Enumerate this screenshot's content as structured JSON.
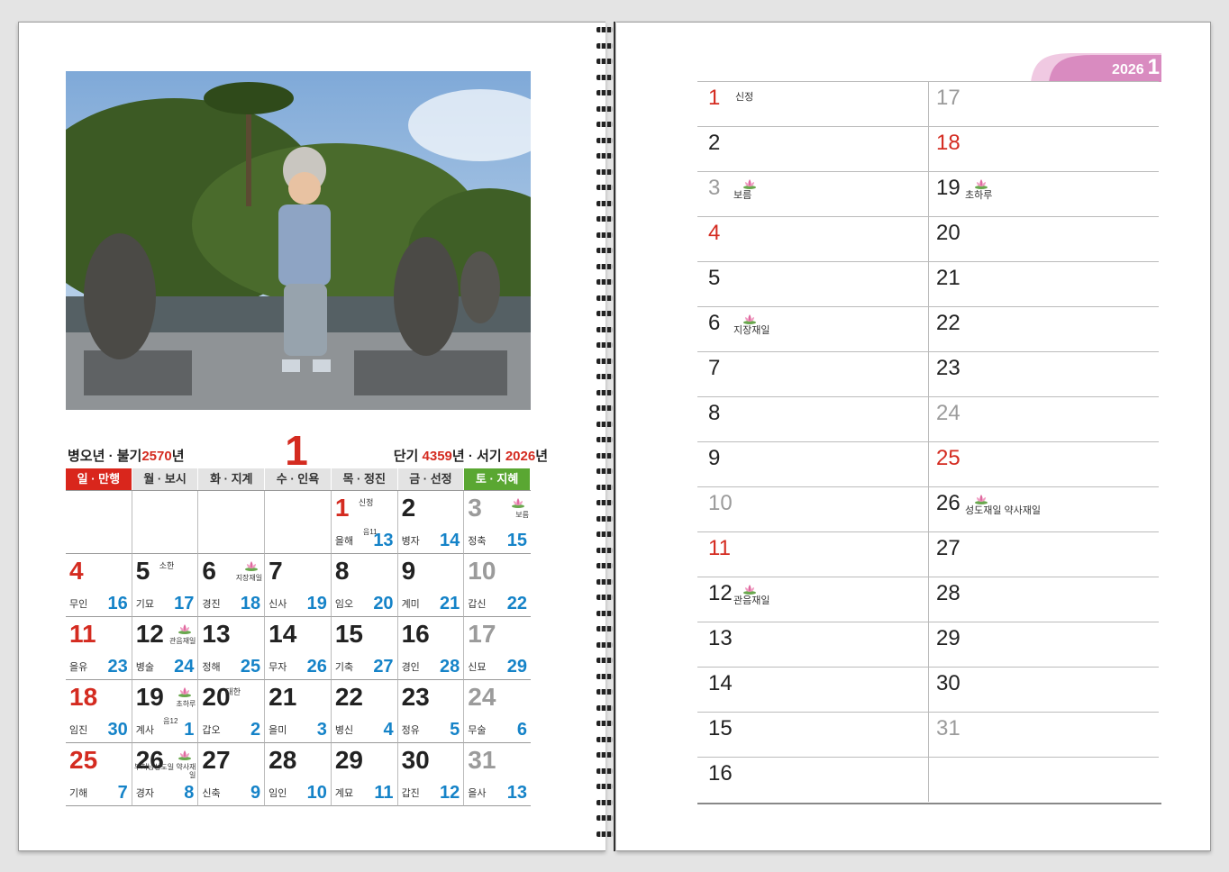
{
  "calendar": {
    "lunar_year_label": "병오년 · 불기",
    "buddhist_year": "2570",
    "year_suffix": "년",
    "month": "1",
    "dangi_label": "단기",
    "dangi_year": "4359",
    "dangi_suffix": "년 · 서기",
    "western_year": "2026",
    "western_suffix": "년",
    "weekdays": [
      {
        "label": "일 · 만행",
        "type": "sun"
      },
      {
        "label": "월 · 보시",
        "type": "day"
      },
      {
        "label": "화 · 지계",
        "type": "day"
      },
      {
        "label": "수 · 인욕",
        "type": "day"
      },
      {
        "label": "목 · 정진",
        "type": "day"
      },
      {
        "label": "금 · 선정",
        "type": "day"
      },
      {
        "label": "토 · 지혜",
        "type": "sat"
      }
    ],
    "cells": [
      {
        "day": "",
        "type": "day",
        "note": "",
        "ganzhi": "",
        "lunar": "",
        "lunar_note": "",
        "lotus": ""
      },
      {
        "day": "",
        "type": "day",
        "note": "",
        "ganzhi": "",
        "lunar": "",
        "lunar_note": "",
        "lotus": ""
      },
      {
        "day": "",
        "type": "day",
        "note": "",
        "ganzhi": "",
        "lunar": "",
        "lunar_note": "",
        "lotus": ""
      },
      {
        "day": "",
        "type": "day",
        "note": "",
        "ganzhi": "",
        "lunar": "",
        "lunar_note": "",
        "lotus": ""
      },
      {
        "day": "1",
        "type": "sun",
        "note": "신정",
        "ganzhi": "을해",
        "lunar": "13",
        "lunar_note": "음11",
        "lotus": ""
      },
      {
        "day": "2",
        "type": "day",
        "note": "",
        "ganzhi": "병자",
        "lunar": "14",
        "lunar_note": "",
        "lotus": ""
      },
      {
        "day": "3",
        "type": "sat",
        "note": "",
        "ganzhi": "정축",
        "lunar": "15",
        "lunar_note": "",
        "lotus": "보름"
      },
      {
        "day": "4",
        "type": "sun",
        "note": "",
        "ganzhi": "무인",
        "lunar": "16",
        "lunar_note": "",
        "lotus": ""
      },
      {
        "day": "5",
        "type": "day",
        "note": "소한",
        "ganzhi": "기묘",
        "lunar": "17",
        "lunar_note": "",
        "lotus": ""
      },
      {
        "day": "6",
        "type": "day",
        "note": "",
        "ganzhi": "경진",
        "lunar": "18",
        "lunar_note": "",
        "lotus": "지장재일"
      },
      {
        "day": "7",
        "type": "day",
        "note": "",
        "ganzhi": "신사",
        "lunar": "19",
        "lunar_note": "",
        "lotus": ""
      },
      {
        "day": "8",
        "type": "day",
        "note": "",
        "ganzhi": "임오",
        "lunar": "20",
        "lunar_note": "",
        "lotus": ""
      },
      {
        "day": "9",
        "type": "day",
        "note": "",
        "ganzhi": "계미",
        "lunar": "21",
        "lunar_note": "",
        "lotus": ""
      },
      {
        "day": "10",
        "type": "sat",
        "note": "",
        "ganzhi": "갑신",
        "lunar": "22",
        "lunar_note": "",
        "lotus": ""
      },
      {
        "day": "11",
        "type": "sun",
        "note": "",
        "ganzhi": "을유",
        "lunar": "23",
        "lunar_note": "",
        "lotus": ""
      },
      {
        "day": "12",
        "type": "day",
        "note": "",
        "ganzhi": "병술",
        "lunar": "24",
        "lunar_note": "",
        "lotus": "관음재일"
      },
      {
        "day": "13",
        "type": "day",
        "note": "",
        "ganzhi": "정해",
        "lunar": "25",
        "lunar_note": "",
        "lotus": ""
      },
      {
        "day": "14",
        "type": "day",
        "note": "",
        "ganzhi": "무자",
        "lunar": "26",
        "lunar_note": "",
        "lotus": ""
      },
      {
        "day": "15",
        "type": "day",
        "note": "",
        "ganzhi": "기축",
        "lunar": "27",
        "lunar_note": "",
        "lotus": ""
      },
      {
        "day": "16",
        "type": "day",
        "note": "",
        "ganzhi": "경인",
        "lunar": "28",
        "lunar_note": "",
        "lotus": ""
      },
      {
        "day": "17",
        "type": "sat",
        "note": "",
        "ganzhi": "신묘",
        "lunar": "29",
        "lunar_note": "",
        "lotus": ""
      },
      {
        "day": "18",
        "type": "sun",
        "note": "",
        "ganzhi": "임진",
        "lunar": "30",
        "lunar_note": "",
        "lotus": ""
      },
      {
        "day": "19",
        "type": "day",
        "note": "",
        "ganzhi": "계사",
        "lunar": "1",
        "lunar_note": "음12",
        "lotus": "초하루"
      },
      {
        "day": "20",
        "type": "day",
        "note": "대한",
        "ganzhi": "갑오",
        "lunar": "2",
        "lunar_note": "",
        "lotus": ""
      },
      {
        "day": "21",
        "type": "day",
        "note": "",
        "ganzhi": "을미",
        "lunar": "3",
        "lunar_note": "",
        "lotus": ""
      },
      {
        "day": "22",
        "type": "day",
        "note": "",
        "ganzhi": "병신",
        "lunar": "4",
        "lunar_note": "",
        "lotus": ""
      },
      {
        "day": "23",
        "type": "day",
        "note": "",
        "ganzhi": "정유",
        "lunar": "5",
        "lunar_note": "",
        "lotus": ""
      },
      {
        "day": "24",
        "type": "sat",
        "note": "",
        "ganzhi": "무술",
        "lunar": "6",
        "lunar_note": "",
        "lotus": ""
      },
      {
        "day": "25",
        "type": "sun",
        "note": "",
        "ganzhi": "기해",
        "lunar": "7",
        "lunar_note": "",
        "lotus": ""
      },
      {
        "day": "26",
        "type": "day",
        "note": "",
        "ganzhi": "경자",
        "lunar": "8",
        "lunar_note": "",
        "lotus": "부처님성도일 약사재일"
      },
      {
        "day": "27",
        "type": "day",
        "note": "",
        "ganzhi": "신축",
        "lunar": "9",
        "lunar_note": "",
        "lotus": ""
      },
      {
        "day": "28",
        "type": "day",
        "note": "",
        "ganzhi": "임인",
        "lunar": "10",
        "lunar_note": "",
        "lotus": ""
      },
      {
        "day": "29",
        "type": "day",
        "note": "",
        "ganzhi": "계묘",
        "lunar": "11",
        "lunar_note": "",
        "lotus": ""
      },
      {
        "day": "30",
        "type": "day",
        "note": "",
        "ganzhi": "갑진",
        "lunar": "12",
        "lunar_note": "",
        "lotus": ""
      },
      {
        "day": "31",
        "type": "sat",
        "note": "",
        "ganzhi": "을사",
        "lunar": "13",
        "lunar_note": "",
        "lotus": ""
      }
    ]
  },
  "planner": {
    "year": "2026",
    "month": "1",
    "col1": [
      {
        "day": "1",
        "type": "sun",
        "note": "신정",
        "lotus": ""
      },
      {
        "day": "2",
        "type": "day",
        "note": "",
        "lotus": ""
      },
      {
        "day": "3",
        "type": "sat",
        "note": "",
        "lotus": "보름"
      },
      {
        "day": "4",
        "type": "sun",
        "note": "",
        "lotus": ""
      },
      {
        "day": "5",
        "type": "day",
        "note": "",
        "lotus": ""
      },
      {
        "day": "6",
        "type": "day",
        "note": "",
        "lotus": "지장재일"
      },
      {
        "day": "7",
        "type": "day",
        "note": "",
        "lotus": ""
      },
      {
        "day": "8",
        "type": "day",
        "note": "",
        "lotus": ""
      },
      {
        "day": "9",
        "type": "day",
        "note": "",
        "lotus": ""
      },
      {
        "day": "10",
        "type": "sat",
        "note": "",
        "lotus": ""
      },
      {
        "day": "11",
        "type": "sun",
        "note": "",
        "lotus": ""
      },
      {
        "day": "12",
        "type": "day",
        "note": "",
        "lotus": "관음재일"
      },
      {
        "day": "13",
        "type": "day",
        "note": "",
        "lotus": ""
      },
      {
        "day": "14",
        "type": "day",
        "note": "",
        "lotus": ""
      },
      {
        "day": "15",
        "type": "day",
        "note": "",
        "lotus": ""
      },
      {
        "day": "16",
        "type": "day",
        "note": "",
        "lotus": ""
      }
    ],
    "col2": [
      {
        "day": "17",
        "type": "sat",
        "note": "",
        "lotus": ""
      },
      {
        "day": "18",
        "type": "sun",
        "note": "",
        "lotus": ""
      },
      {
        "day": "19",
        "type": "day",
        "note": "",
        "lotus": "초하루"
      },
      {
        "day": "20",
        "type": "day",
        "note": "",
        "lotus": ""
      },
      {
        "day": "21",
        "type": "day",
        "note": "",
        "lotus": ""
      },
      {
        "day": "22",
        "type": "day",
        "note": "",
        "lotus": ""
      },
      {
        "day": "23",
        "type": "day",
        "note": "",
        "lotus": ""
      },
      {
        "day": "24",
        "type": "sat",
        "note": "",
        "lotus": ""
      },
      {
        "day": "25",
        "type": "sun",
        "note": "",
        "lotus": ""
      },
      {
        "day": "26",
        "type": "day",
        "note": "",
        "lotus": "성도재일 약사재일"
      },
      {
        "day": "27",
        "type": "day",
        "note": "",
        "lotus": ""
      },
      {
        "day": "28",
        "type": "day",
        "note": "",
        "lotus": ""
      },
      {
        "day": "29",
        "type": "day",
        "note": "",
        "lotus": ""
      },
      {
        "day": "30",
        "type": "day",
        "note": "",
        "lotus": ""
      },
      {
        "day": "31",
        "type": "sat",
        "note": "",
        "lotus": ""
      },
      {
        "day": "",
        "type": "day",
        "note": "",
        "lotus": ""
      }
    ]
  },
  "colors": {
    "sunday_red": "#d42b20",
    "saturday_green": "#5aa732",
    "lunar_blue": "#1583c8",
    "tab_pink": "#d98bc0"
  }
}
